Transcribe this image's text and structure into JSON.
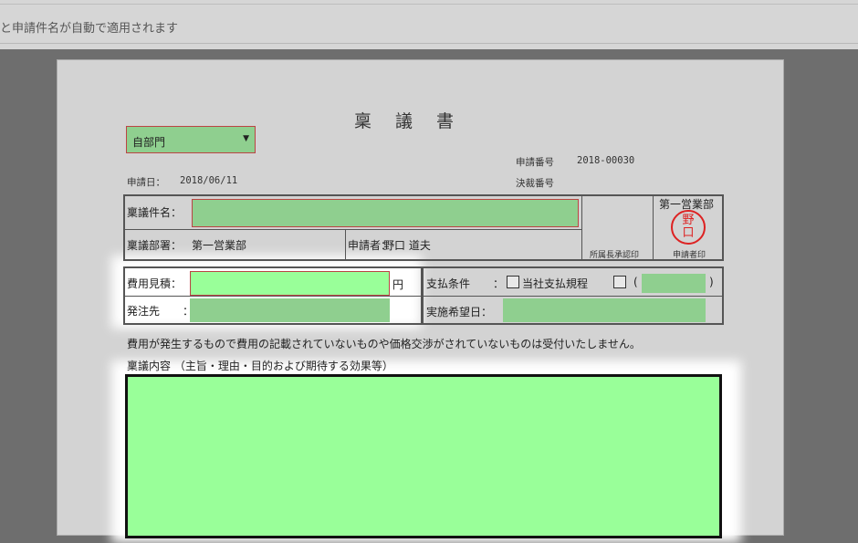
{
  "hint_bar": {
    "text": "と申請件名が自動で適用されます"
  },
  "form": {
    "title": "稟議書",
    "department_select": {
      "value": "自部門"
    },
    "application_number": {
      "label": "申請番号",
      "value": "2018-00030"
    },
    "decision_number": {
      "label": "決裁番号"
    },
    "application_date": {
      "label": "申請日：",
      "value": "2018/06/11"
    },
    "subject": {
      "label": "稟議件名："
    },
    "department": {
      "label": "稟議部署：",
      "value": "第一営業部"
    },
    "applicant": {
      "label": "申請者：",
      "value": "野口 道夫"
    },
    "approval_column": {
      "label": "所属長承認印"
    },
    "stamp_column": {
      "header": "第一営業部",
      "label": "申請者印",
      "seal_top": "野",
      "seal_bottom": "口"
    },
    "cost_estimate": {
      "label": "費用見積：",
      "unit": "円"
    },
    "vendor": {
      "label": "発注先",
      "colon": "："
    },
    "payment_terms": {
      "label": "支払条件",
      "colon": "：",
      "option1": "当社支払規程",
      "paren_open": "(",
      "paren_close": ")"
    },
    "desired_date": {
      "label": "実施希望日："
    },
    "notice": "費用が発生するもので費用の記載されていないものや価格交渉がされていないものは受付いたしません。",
    "content": {
      "label": "稟議内容 （主旨・理由・目的および期待する効果等）"
    }
  },
  "colors": {
    "field_green": "#8fcf8f",
    "bright_green": "#99ff99",
    "border_red": "#b44444",
    "seal_red": "#dd2222"
  }
}
